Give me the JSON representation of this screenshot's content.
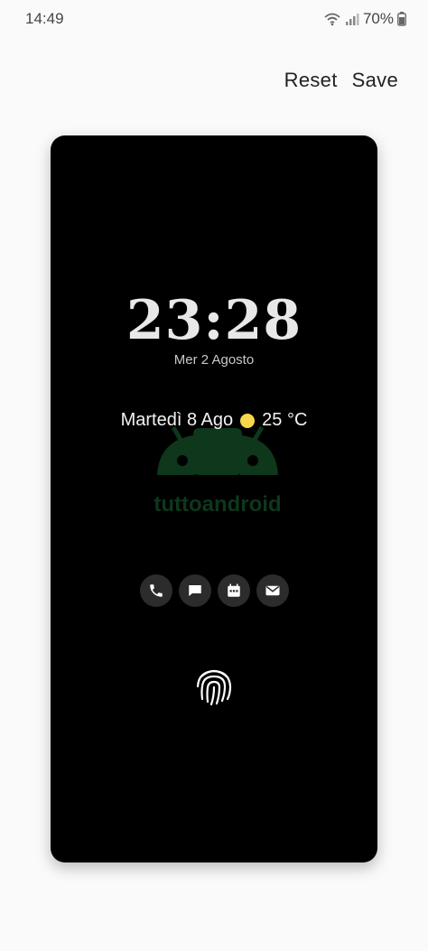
{
  "status_bar": {
    "time": "14:49",
    "battery": "70%"
  },
  "actions": {
    "reset_label": "Reset",
    "save_label": "Save"
  },
  "preview": {
    "clock": "23:28",
    "small_date": "Mer 2 Agosto",
    "weather_date": "Martedì 8 Ago",
    "temperature": "25 °C",
    "watermark_text": "tuttoandroid",
    "notification_icons": [
      "phone-icon",
      "message-icon",
      "calendar-icon",
      "email-icon"
    ],
    "fingerprint_icon": "fingerprint-icon"
  },
  "colors": {
    "page_background": "#fafafa",
    "preview_background": "#000000",
    "sun": "#f7d84a",
    "watermark_green": "#1f7a3c"
  }
}
